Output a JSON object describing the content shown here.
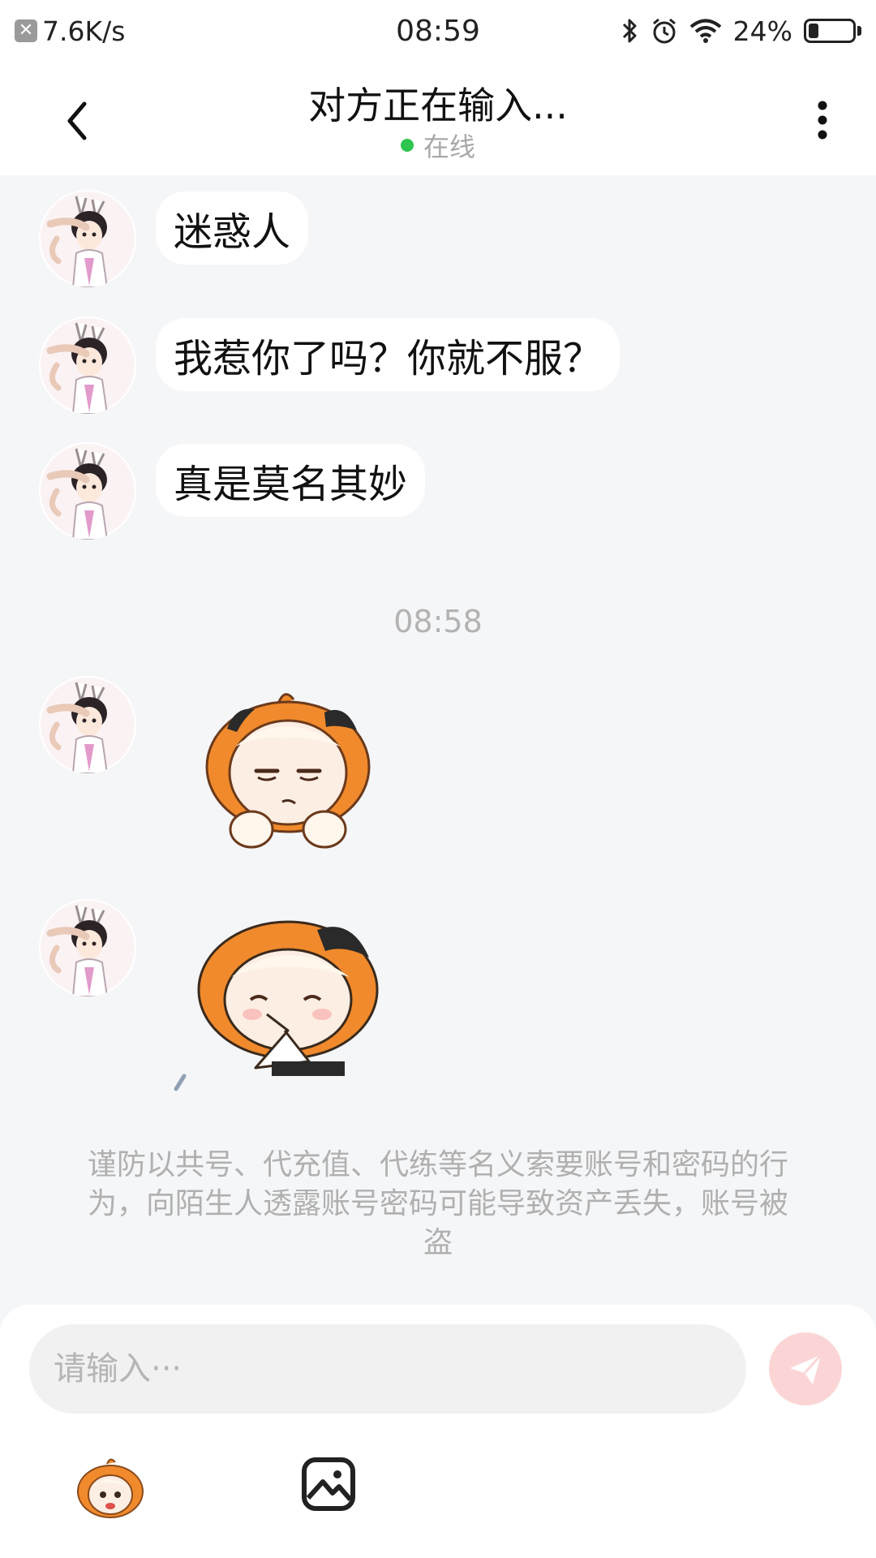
{
  "status_bar": {
    "net_speed": "7.6K/s",
    "net_icon_glyph": "✕",
    "time": "08:59",
    "battery_percent": "24%",
    "battery_level": 0.24,
    "icons": [
      "bluetooth-icon",
      "alarm-icon",
      "wifi-icon",
      "battery-icon"
    ]
  },
  "header": {
    "title": "对方正在输入...",
    "status": "在线",
    "status_color": "#2ec54e"
  },
  "messages": [
    {
      "text": "迷惑人"
    },
    {
      "text": "我惹你了吗？你就不服？"
    },
    {
      "text": "真是莫名其妙"
    }
  ],
  "time_divider": "08:58",
  "stickers": [
    "sticker-unimpressed-girl",
    "sticker-crying-girl"
  ],
  "notice": "谨防以共号、代充值、代练等名义索要账号和密码的行为，向陌生人透露账号密码可能导致资产丢失，账号被盗",
  "input": {
    "placeholder": "请输入···",
    "value": ""
  },
  "toolbar": {
    "icons": [
      "emoji-sticker-icon",
      "image-icon"
    ]
  },
  "colors": {
    "background": "#f5f6f8",
    "bubble": "#ffffff",
    "send_button": "#fbd5d5",
    "sticker_orange": "#f08a2c"
  }
}
